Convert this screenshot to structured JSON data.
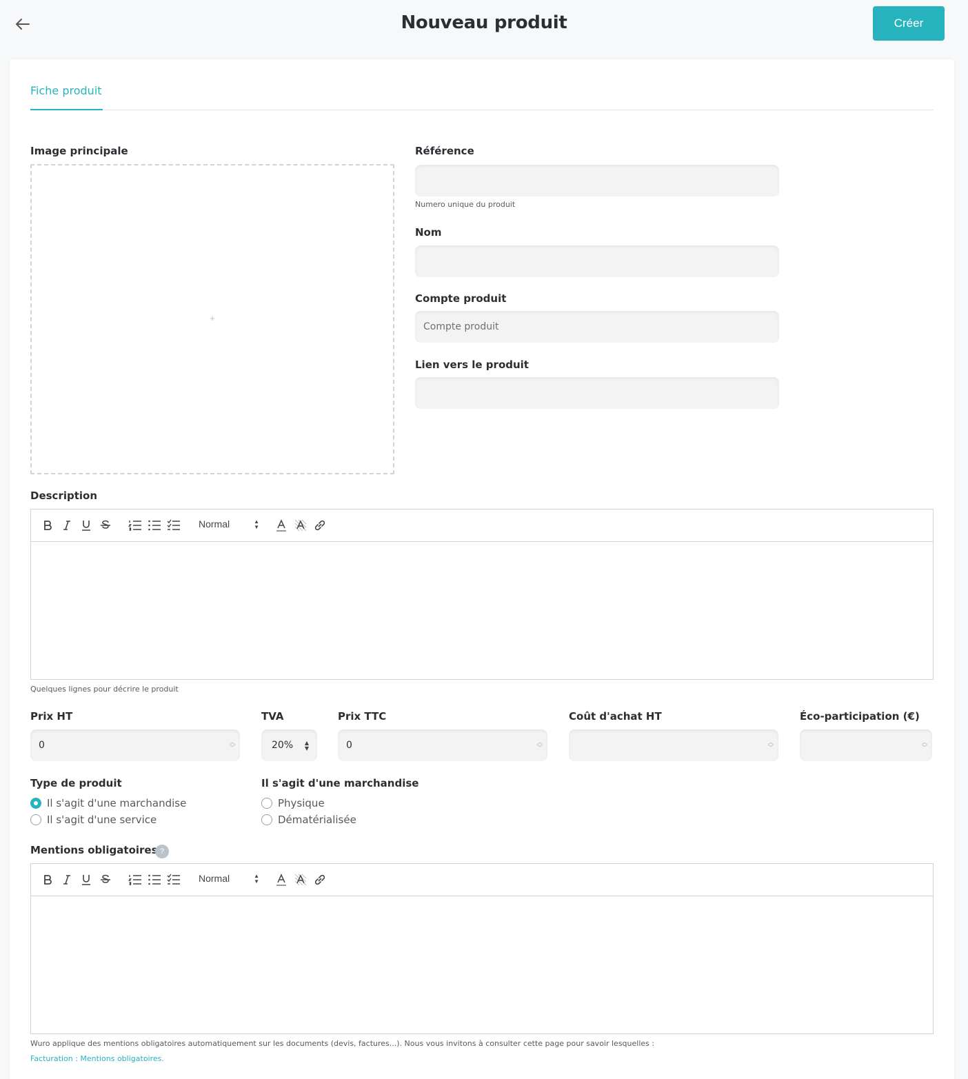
{
  "header": {
    "title": "Nouveau produit",
    "create_label": "Créer"
  },
  "tabs": [
    {
      "label": "Fiche produit"
    }
  ],
  "image": {
    "label": "Image principale",
    "plus": "+"
  },
  "reference": {
    "label": "Référence",
    "value": "",
    "hint": "Numero unique du produit"
  },
  "name": {
    "label": "Nom",
    "value": ""
  },
  "account": {
    "label": "Compte produit",
    "placeholder": "Compte produit"
  },
  "link": {
    "label": "Lien vers le produit",
    "value": ""
  },
  "description": {
    "label": "Description",
    "format": "Normal",
    "hint": "Quelques lignes pour décrire le produit"
  },
  "pricing": {
    "price_ht_label": "Prix HT",
    "price_ht_value": "0",
    "tva_label": "TVA",
    "tva_value": "20%",
    "price_ttc_label": "Prix TTC",
    "price_ttc_value": "0",
    "cost_label": "Coût d'achat HT",
    "cost_value": "",
    "eco_label": "Éco-participation (€)",
    "eco_value": ""
  },
  "product_type": {
    "label": "Type de produit",
    "options": [
      "Il s'agit d'une marchandise",
      "Il s'agit d'une service"
    ],
    "selected": 0
  },
  "goods_type": {
    "label": "Il s'agit d'une marchandise",
    "options": [
      "Physique",
      "Dématérialisée"
    ]
  },
  "mentions": {
    "label": "Mentions obligatoires",
    "help": "?",
    "format": "Normal",
    "footer_text": "Wuro applique des mentions obligatoires automatiquement sur les documents (devis, factures...). Nous vous invitons à consulter cette page pour savoir lesquelles :",
    "footer_link": "Facturation : Mentions obligatoires."
  },
  "colors": {
    "accent": "#27b3bd",
    "text": "#2b2f33",
    "border": "#cfd3d6"
  }
}
